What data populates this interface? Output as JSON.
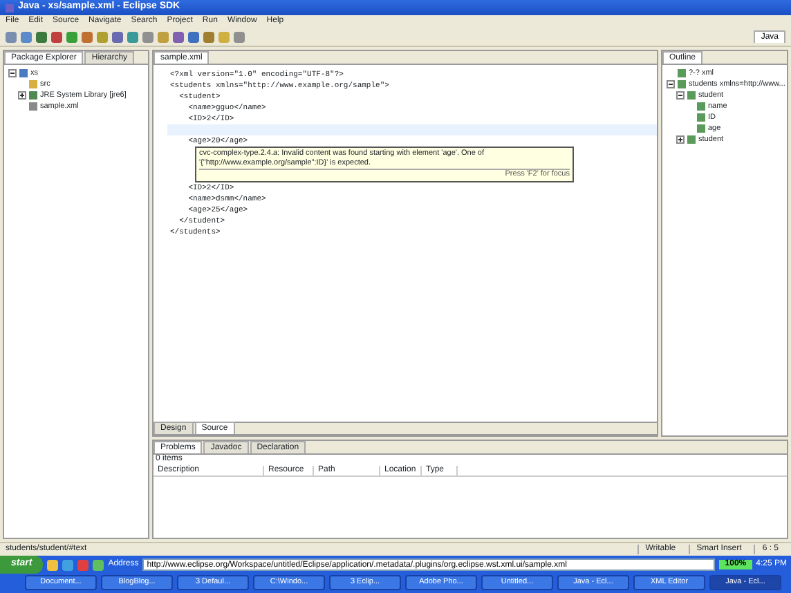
{
  "window": {
    "title": "Java - xs/sample.xml - Eclipse SDK"
  },
  "menu": [
    "File",
    "Edit",
    "Source",
    "Navigate",
    "Search",
    "Project",
    "Run",
    "Window",
    "Help"
  ],
  "perspective": {
    "label": "Java",
    "selected": true
  },
  "left_panel": {
    "tabs": [
      {
        "label": "Package Explorer",
        "selected": true
      },
      {
        "label": "Hierarchy",
        "selected": false
      }
    ],
    "tree": [
      {
        "label": "xs",
        "expanded": true,
        "kind": "project",
        "children": [
          {
            "label": "src",
            "kind": "folder"
          },
          {
            "label": "JRE System Library [jre6]",
            "kind": "library",
            "expanded": false
          },
          {
            "label": "sample.xml",
            "kind": "file"
          }
        ]
      }
    ]
  },
  "editor": {
    "tab": "sample.xml",
    "lines": [
      {
        "text": "<?xml version=\"1.0\" encoding=\"UTF-8\"?>",
        "current": false
      },
      {
        "text": "<students xmlns=\"http://www.example.org/sample\">",
        "current": false
      },
      {
        "text": "  <student>",
        "current": false
      },
      {
        "text": "    <name>gguo</name>",
        "current": false
      },
      {
        "text": "    <ID>2</ID>",
        "current": false
      },
      {
        "current": true
      },
      {
        "text": "    <age>20</age>",
        "current": false,
        "tooltip": {
          "message": "cvc-complex-type.2.4.a: Invalid content was found starting with element 'age'. One of '{\"http://www.example.org/sample\":ID}' is expected.",
          "hint": "Press 'F2' for focus"
        }
      },
      {
        "text": "    <ID>2</ID>",
        "current": false
      },
      {
        "text": "    <name>dsmm</name>",
        "current": false
      },
      {
        "text": "    <age>25</age>",
        "current": false
      },
      {
        "text": "  </student>",
        "current": false
      },
      {
        "text": "</students>",
        "current": false
      }
    ],
    "bottom_tabs": [
      {
        "label": "Design",
        "selected": false
      },
      {
        "label": "Source",
        "selected": true
      }
    ]
  },
  "outline": {
    "tab": "Outline",
    "tree": [
      {
        "label": "?-? xml"
      },
      {
        "label": "students xmlns=http://www...",
        "expanded": true,
        "children": [
          {
            "label": "student",
            "expanded": true,
            "children": [
              {
                "label": "name"
              },
              {
                "label": "ID"
              },
              {
                "label": "age"
              }
            ]
          },
          {
            "label": "student",
            "expanded": false
          }
        ]
      }
    ]
  },
  "problems": {
    "tabs": [
      {
        "label": "Problems",
        "selected": true
      },
      {
        "label": "Javadoc",
        "selected": false
      },
      {
        "label": "Declaration",
        "selected": false
      }
    ],
    "summary": "0 items",
    "columns": [
      "Description",
      "Resource",
      "Path",
      "Location",
      "Type"
    ]
  },
  "status_bar": {
    "path": "students/student/#text",
    "mode": "Writable",
    "insert": "Smart Insert",
    "position": "6 : 5"
  },
  "taskbar": {
    "start": "start",
    "address_label": "Address",
    "address": "http://www.eclipse.org/Workspace/untitled/Eclipse/application/.metadata/.plugins/org.eclipse.wst.xml.ui/sample.xml",
    "zoom": "100%",
    "tasks": [
      {
        "label": "Document...",
        "selected": false
      },
      {
        "label": "BlogBlog...",
        "selected": false
      },
      {
        "label": "3 Defaul...",
        "selected": false
      },
      {
        "label": "C:\\Windo...",
        "selected": false
      },
      {
        "label": "3 Eclip...",
        "selected": false
      },
      {
        "label": "Adobe Pho...",
        "selected": false
      },
      {
        "label": "Untitled...",
        "selected": false
      },
      {
        "label": "Java - Ecl...",
        "selected": false
      },
      {
        "label": "XML Editor",
        "selected": false
      },
      {
        "label": "Java - Ecl...",
        "selected": true
      }
    ],
    "clock": "4:25 PM"
  }
}
